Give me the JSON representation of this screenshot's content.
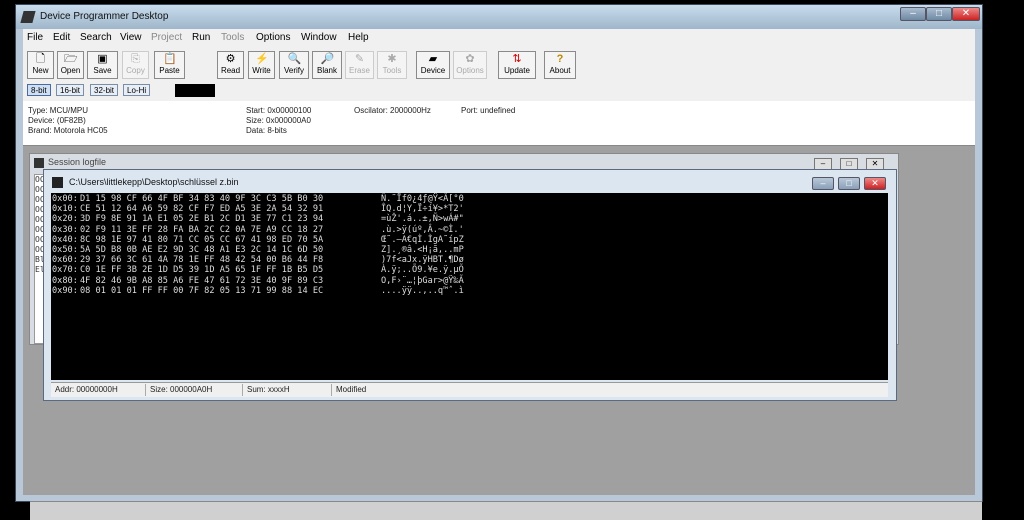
{
  "window": {
    "title": "Device Programmer Desktop",
    "minimize": "–",
    "maximize": "□",
    "close": "✕"
  },
  "menu": [
    "File",
    "Edit",
    "Search",
    "View",
    "Project",
    "Run",
    "Tools",
    "Options",
    "Window",
    "Help"
  ],
  "menu_disabled": [
    "Project",
    "Tools"
  ],
  "toolbar": {
    "new": "New",
    "open": "Open",
    "save": "Save",
    "copy": "Copy",
    "paste": "Paste",
    "read": "Read",
    "write": "Write",
    "verify": "Verify",
    "blank": "Blank",
    "erase": "Erase",
    "tools": "Tools",
    "device": "Device",
    "options": "Options",
    "update": "Update",
    "about": "About"
  },
  "bitbar": {
    "b8": "8-bit",
    "b16": "16-bit",
    "b32": "32-bit",
    "lohi": "Lo-Hi"
  },
  "info": {
    "type": "Type: MCU/MPU",
    "device": "Device: (0F82B)",
    "brand": "Brand: Motorola HC05",
    "start": "Start: 0x00000100",
    "size": "Size: 0x000000A0",
    "data": "Data: 8-bits",
    "oscillator": "Oscilator: 2000000Hz",
    "port": "Port: undefined"
  },
  "log": {
    "title": "Session logfile",
    "lines": [
      "OC",
      "OC",
      "OC",
      "OC",
      "OC",
      "OC",
      "OC",
      "OC",
      "Bl",
      "El"
    ]
  },
  "hexwin": {
    "title": "C:\\Users\\littlekepp\\Desktop\\schlüssel z.bin",
    "rows": [
      {
        "addr": "0x00:",
        "bytes": "D1 15 98 CF 66 4F BF 34 83 40 9F 3C C3 5B B0 30",
        "ascii": "Ñ.˜Ïf0¿4ƒ@Ÿ<Ã[°0"
      },
      {
        "addr": "0x10:",
        "bytes": "CE 51 12 64 A6 59 82 CF F7 ED A5 3E 2A 54 32 91",
        "ascii": "ÎQ.d¦Y‚Ï÷í¥>*T2'"
      },
      {
        "addr": "0x20:",
        "bytes": "3D F9 8E 91 1A E1 05 2E B1 2C D1 3E 77 C1 23 94",
        "ascii": "=ùŽ'.á..±,Ñ>wÁ#\""
      },
      {
        "addr": "0x30:",
        "bytes": "02 F9 11 3E FF 28 FA BA 2C C2 0A 7E A9 CC 18 27",
        "ascii": ".ù.>ÿ(úº,Â.~©Ì.'"
      },
      {
        "addr": "0x40:",
        "bytes": "8C 98 1E 97 41 80 71 CC 05 CC 67 41 98 ED 70 5A",
        "ascii": "Œ˜.—A€qÌ.ÌgA˜ípZ"
      },
      {
        "addr": "0x50:",
        "bytes": "5A 5D B8 0B AE E2 9D 3C 48 A1 E3 2C 14 1C 6D 50",
        "ascii": "Z].¸®â.<H¡ã,..mP"
      },
      {
        "addr": "0x60:",
        "bytes": "29 37 66 3C 61 4A 78 1E FF 48 42 54 00 B6 44 F8",
        "ascii": ")7f<aJx.ÿHBT.¶Dø"
      },
      {
        "addr": "0x70:",
        "bytes": "C0 1E FF 3B 2E 1D D5 39 1D A5 65 1F FF 1B B5 D5",
        "ascii": "À.ÿ;..Õ9.¥e.ÿ.µÕ"
      },
      {
        "addr": "0x80:",
        "bytes": "4F 82 46 9B A8 85 A6 FE 47 61 72 3E 40 9F 89 C3",
        "ascii": "O‚F›¨…¦þGar>@Ÿ‰Ã"
      },
      {
        "addr": "0x90:",
        "bytes": "08 01 01 01 FF FF 00 7F 82 05 13 71 99 88 14 EC",
        "ascii": "....ÿÿ..‚..q™ˆ.ì"
      }
    ],
    "status": {
      "addr": "Addr: 00000000H",
      "size": "Size: 000000A0H",
      "sum": "Sum: xxxxH",
      "modified": "Modified"
    }
  }
}
